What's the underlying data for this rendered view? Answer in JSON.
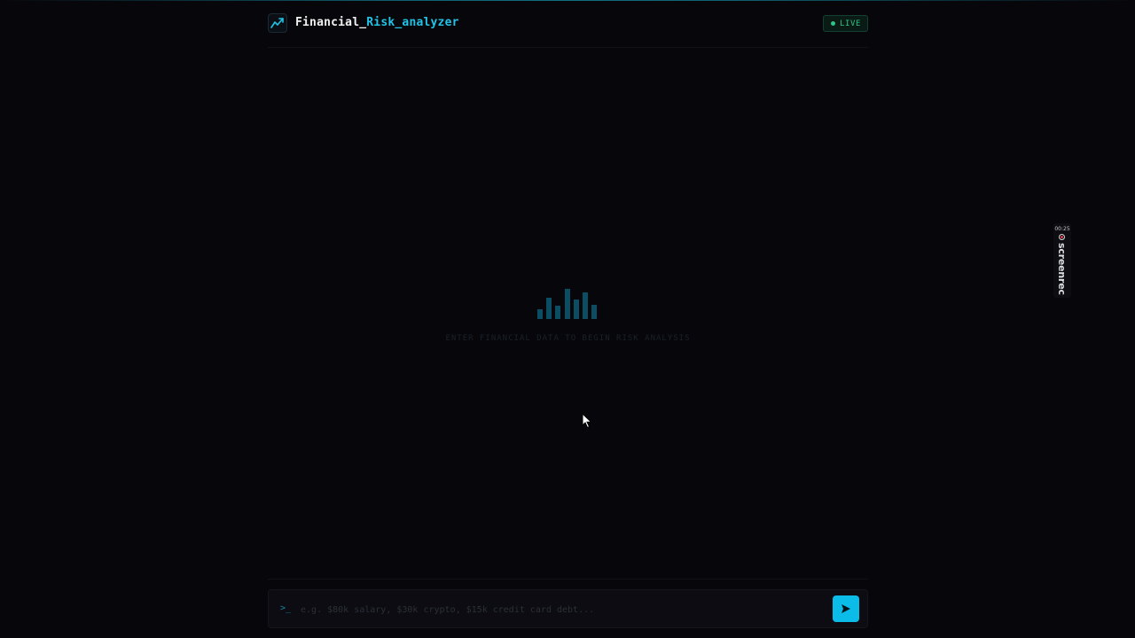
{
  "header": {
    "brand_part1": "Financial_",
    "brand_part2": "Risk_analyzer",
    "status_badge": "LIVE",
    "logo_icon": "trending-up-icon"
  },
  "colors": {
    "background": "#07070b",
    "accent_cyan": "#22c3e6",
    "live_green": "#2fc48a",
    "send_button": "#0bbbe8",
    "chart_bars": "#0b4d62"
  },
  "empty_state": {
    "icon": "bar-chart-icon",
    "message": "ENTER FINANCIAL DATA TO BEGIN RISK ANALYSIS"
  },
  "input": {
    "prompt_symbol": ">_",
    "placeholder": "e.g. $80k salary, $30k crypto, $15k credit card debt...",
    "value": "",
    "send_icon": "send-icon"
  },
  "recorder_overlay": {
    "timer": "00:25",
    "label": "screenrec"
  }
}
